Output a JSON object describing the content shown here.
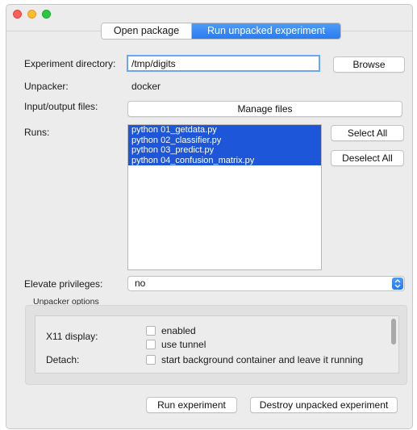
{
  "tabs": {
    "open_package": "Open package",
    "run_unpacked": "Run unpacked experiment"
  },
  "form": {
    "experiment_directory_label": "Experiment directory:",
    "experiment_directory_value": "/tmp/digits",
    "browse_label": "Browse",
    "unpacker_label": "Unpacker:",
    "unpacker_value": "docker",
    "io_files_label": "Input/output files:",
    "manage_files_label": "Manage files",
    "runs_label": "Runs:",
    "runs": [
      "python 01_getdata.py",
      "python 02_classifier.py",
      "python 03_predict.py",
      "python 04_confusion_matrix.py"
    ],
    "select_all_label": "Select All",
    "deselect_all_label": "Deselect All",
    "elevate_label": "Elevate privileges:",
    "elevate_value": "no"
  },
  "unpacker_options": {
    "title": "Unpacker options",
    "x11_label": "X11 display:",
    "enabled_label": "enabled",
    "use_tunnel_label": "use tunnel",
    "detach_label": "Detach:",
    "detach_option_label": "start background container and leave it running"
  },
  "actions": {
    "run_label": "Run experiment",
    "destroy_label": "Destroy unpacked experiment"
  },
  "colors": {
    "accent": "#2a7cf0",
    "selection": "#1d56d9"
  }
}
